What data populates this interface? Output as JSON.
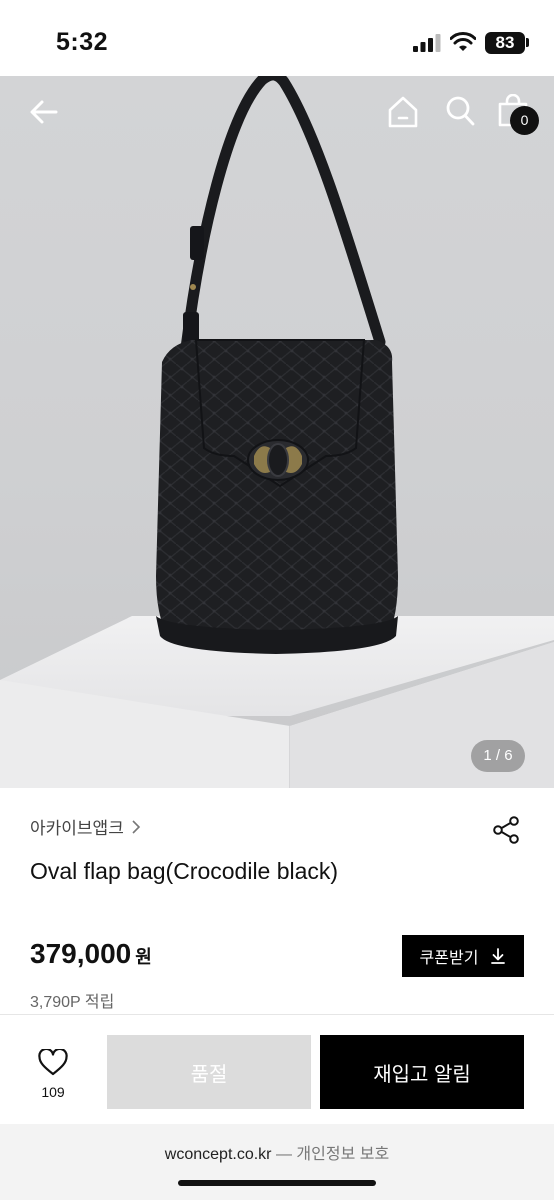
{
  "status_bar": {
    "time": "5:32",
    "battery": "83",
    "icons": [
      "signal-icon",
      "wifi-icon",
      "battery-icon"
    ]
  },
  "nav": {
    "icons": [
      "back-arrow-icon",
      "home-icon",
      "search-icon",
      "cart-icon"
    ],
    "cart_count": "0"
  },
  "gallery": {
    "indicator": "1 / 6"
  },
  "product": {
    "brand": "아카이브앱크",
    "title": "Oval flap bag(Crocodile black)",
    "price": "379,000",
    "currency": "원",
    "points": "3,790P 적립",
    "coupon_label": "쿠폰받기"
  },
  "actions": {
    "like_count": "109",
    "soldout_label": "품절",
    "restock_label": "재입고 알림"
  },
  "browser": {
    "domain": "wconcept.co.kr",
    "separator": "—",
    "privacy": "개인정보 보호"
  },
  "colors": {
    "accent": "#000000",
    "soldout_bg": "#dcdcdc",
    "text_secondary": "#666666"
  }
}
